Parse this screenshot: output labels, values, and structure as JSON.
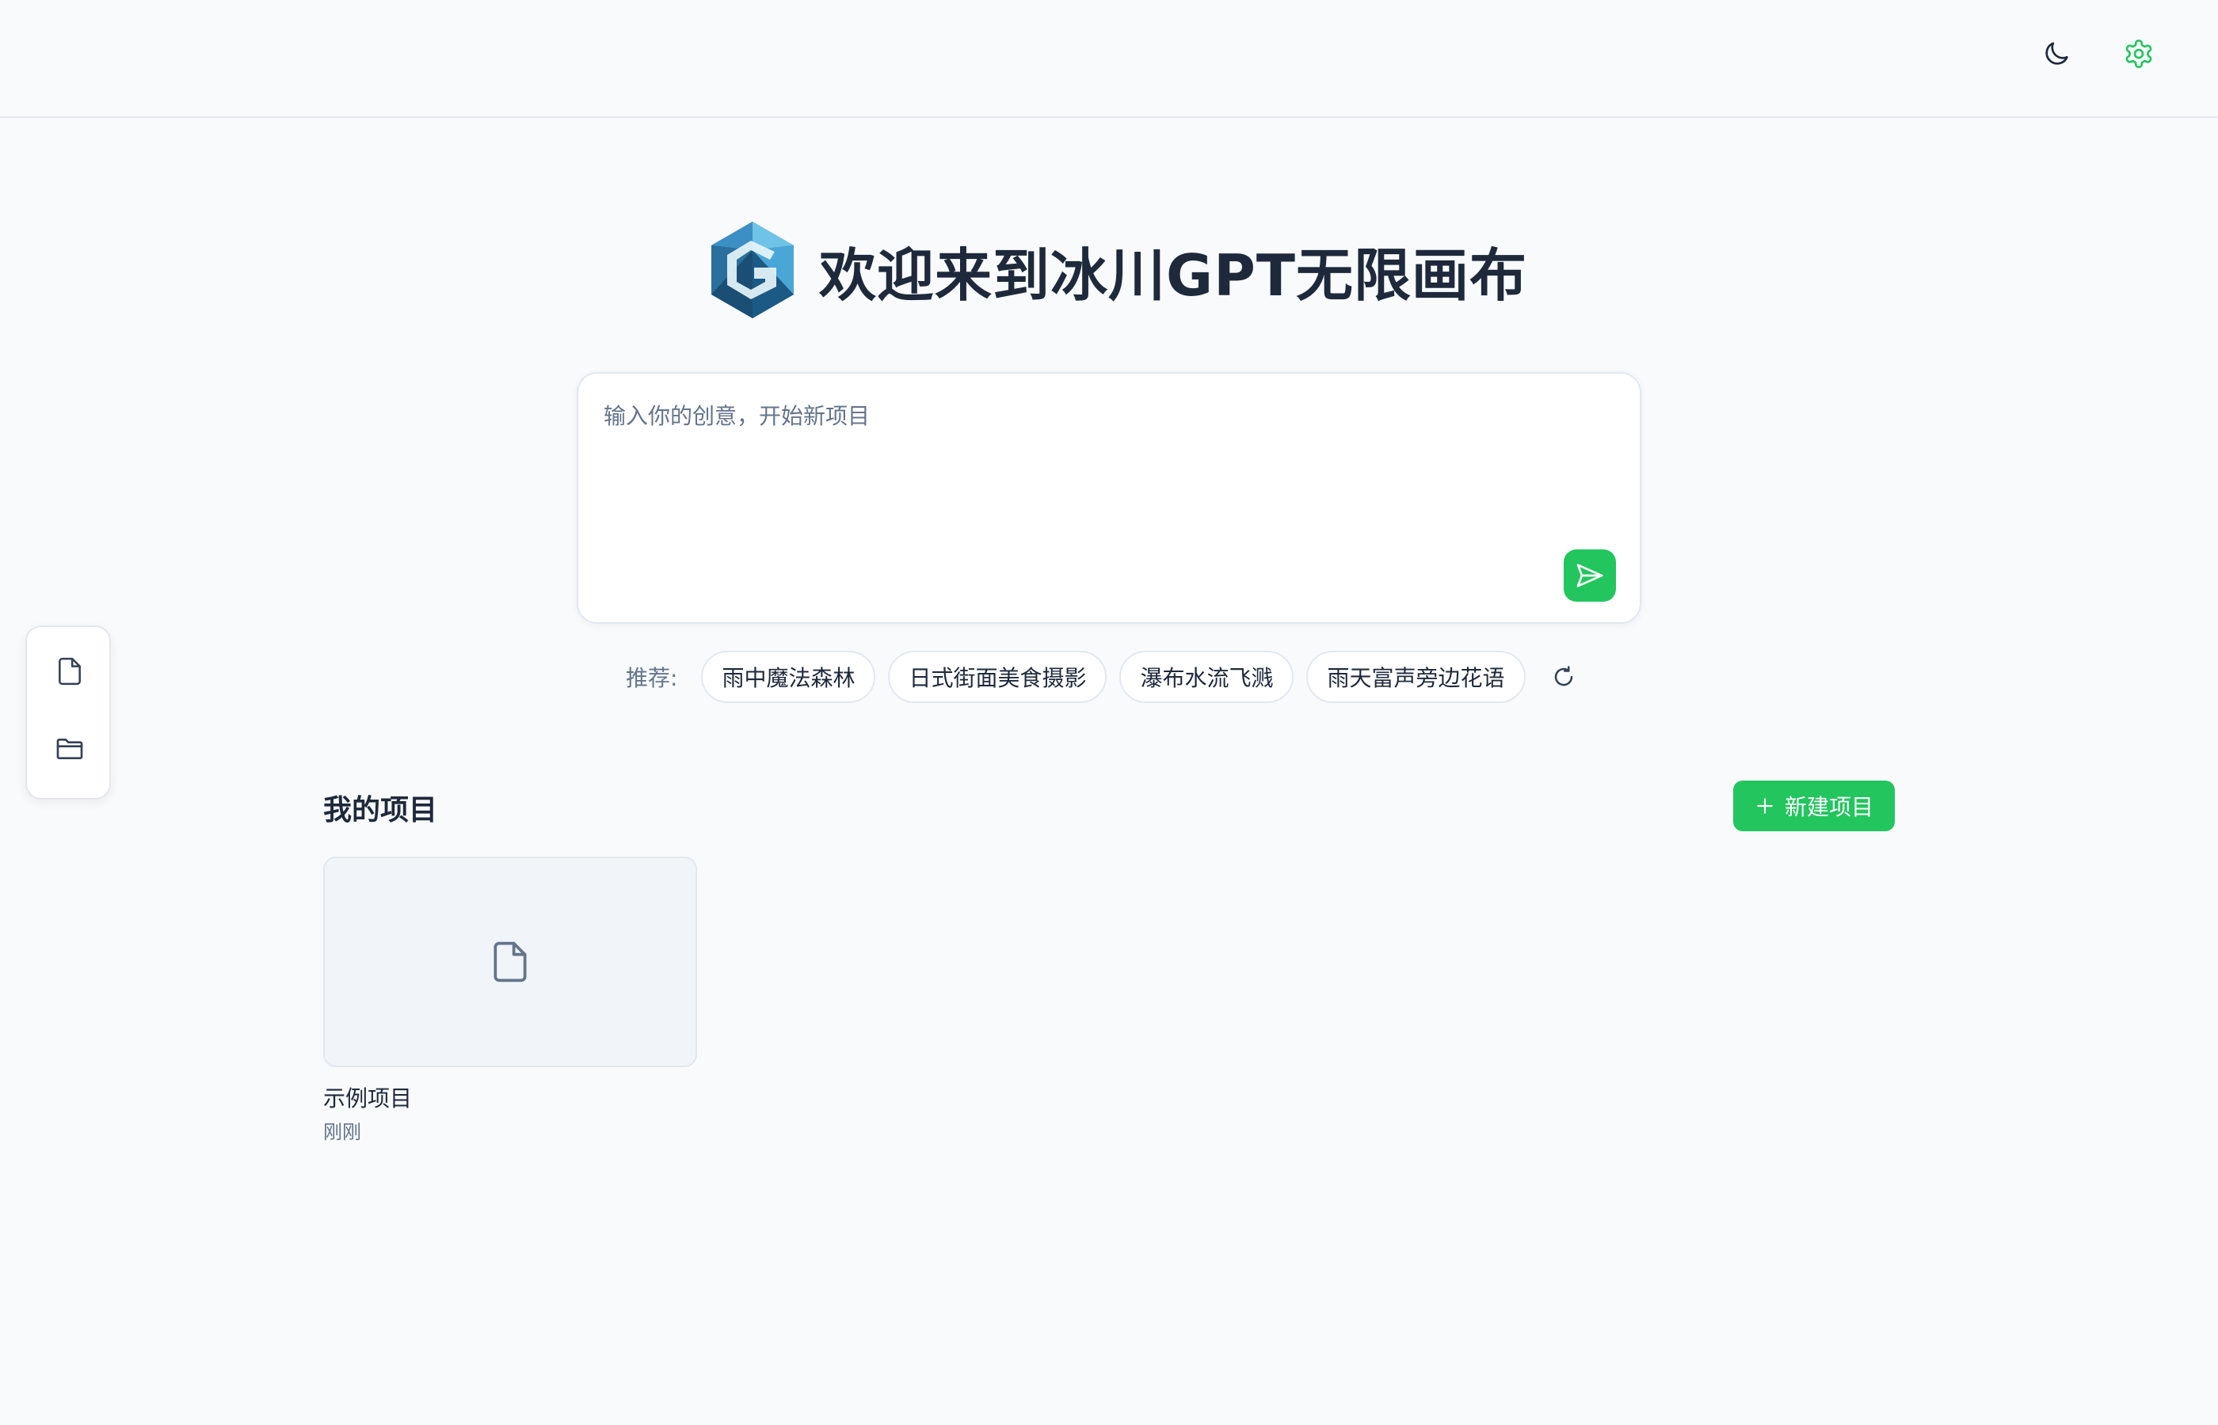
{
  "colors": {
    "accent": "#22c55e",
    "background": "#f8fafc",
    "text": "#1e293b",
    "muted": "#64748b",
    "border": "#e2e8f0"
  },
  "header": {
    "icons": [
      "moon-icon",
      "gear-icon"
    ]
  },
  "sidebar": {
    "icons": [
      "file-icon",
      "folder-icon"
    ]
  },
  "hero": {
    "logo_icon": "crystal-g-logo",
    "title": "欢迎来到冰川GPT无限画布"
  },
  "prompt": {
    "placeholder": "输入你的创意，开始新项目",
    "value": "",
    "send_icon": "send-icon"
  },
  "suggestions": {
    "label": "推荐:",
    "items": [
      "雨中魔法森林",
      "日式街面美食摄影",
      "瀑布水流飞溅",
      "雨天富声旁边花语"
    ],
    "refresh_icon": "refresh-icon"
  },
  "projects": {
    "title": "我的项目",
    "new_button_label": "新建项目",
    "items": [
      {
        "name": "示例项目",
        "time": "刚刚",
        "icon": "file-icon"
      }
    ]
  }
}
